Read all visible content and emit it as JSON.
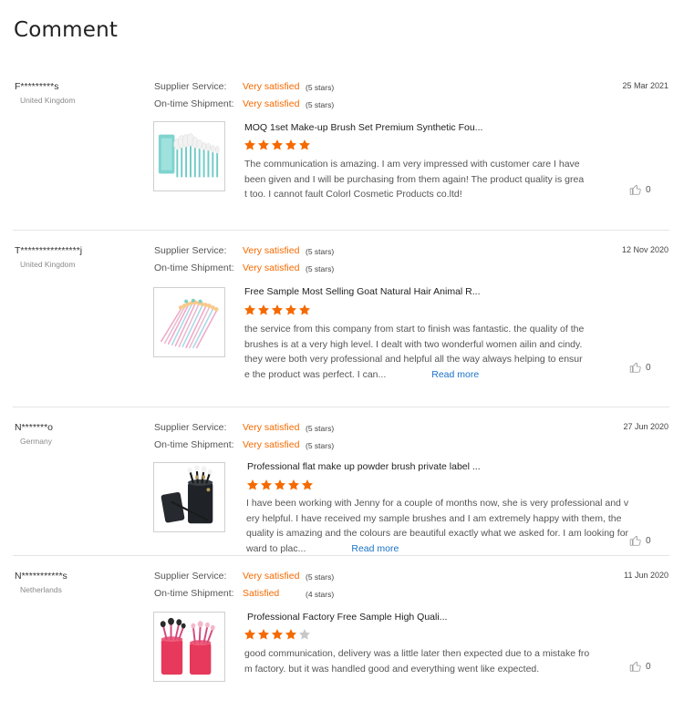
{
  "page": {
    "title": "Comment"
  },
  "labels": {
    "supplier_service": "Supplier Service:",
    "on_time_shipment": "On-time Shipment:",
    "read_more": "Read more"
  },
  "colors": {
    "accent": "#f56a00",
    "star_empty": "#c8c8c8",
    "link": "#1a73c8"
  },
  "icons": {
    "like": "thumbs-up-icon",
    "star": "star-icon"
  },
  "reviews": [
    {
      "buyer": "F*********s",
      "country": "United Kingdom",
      "date": "25 Mar 2021",
      "supplier_service": {
        "text": "Very satisfied",
        "stars": "(5 stars)"
      },
      "on_time_shipment": {
        "text": "Very satisfied",
        "stars": "(5 stars)"
      },
      "product_title": "MOQ 1set Make-up Brush Set Premium Synthetic Fou...",
      "rating": 5,
      "text": "The communication is amazing. I am very impressed with customer care I have been given and I will be purchasing from them again! The product quality is great too. I cannot fault Colorl Cosmetic Products co.ltd!",
      "read_more": false,
      "likes": "0"
    },
    {
      "buyer": "T****************j",
      "country": "United Kingdom",
      "date": "12 Nov 2020",
      "supplier_service": {
        "text": "Very satisfied",
        "stars": "(5 stars)"
      },
      "on_time_shipment": {
        "text": "Very satisfied",
        "stars": "(5 stars)"
      },
      "product_title": "Free Sample Most Selling Goat Natural Hair Animal R...",
      "rating": 5,
      "text": "the service from this company from start to finish was fantastic. the quality of the brushes is at a very high level. I dealt with two wonderful women ailin and cindy. they were both very professional and helpful all the way always helping to ensure the product was perfect. I can...",
      "read_more": true,
      "likes": "0"
    },
    {
      "buyer": "N*******o",
      "country": "Germany",
      "date": "27 Jun 2020",
      "supplier_service": {
        "text": "Very satisfied",
        "stars": "(5 stars)"
      },
      "on_time_shipment": {
        "text": "Very satisfied",
        "stars": "(5 stars)"
      },
      "product_title": "Professional flat make up powder brush private label ...",
      "rating": 5,
      "text": "I have been working with Jenny for a couple of months now, she is very professional and very helpful. I have received my sample brushes and I am extremely happy with them, the quality is amazing and the colours are beautiful exactly what we asked for. I am looking forward to plac...",
      "read_more": true,
      "likes": "0"
    },
    {
      "buyer": "N***********s",
      "country": "Netherlands",
      "date": "11 Jun 2020",
      "supplier_service": {
        "text": "Very satisfied",
        "stars": "(5 stars)"
      },
      "on_time_shipment": {
        "text": "Satisfied",
        "stars": "(4 stars)"
      },
      "product_title": "Professional Factory Free Sample High Quali...",
      "rating": 4,
      "text": "good communication, delivery was a little later then expected due to a mistake from factory. but it was handled good and everything went like expected.",
      "read_more": false,
      "likes": "0"
    }
  ]
}
